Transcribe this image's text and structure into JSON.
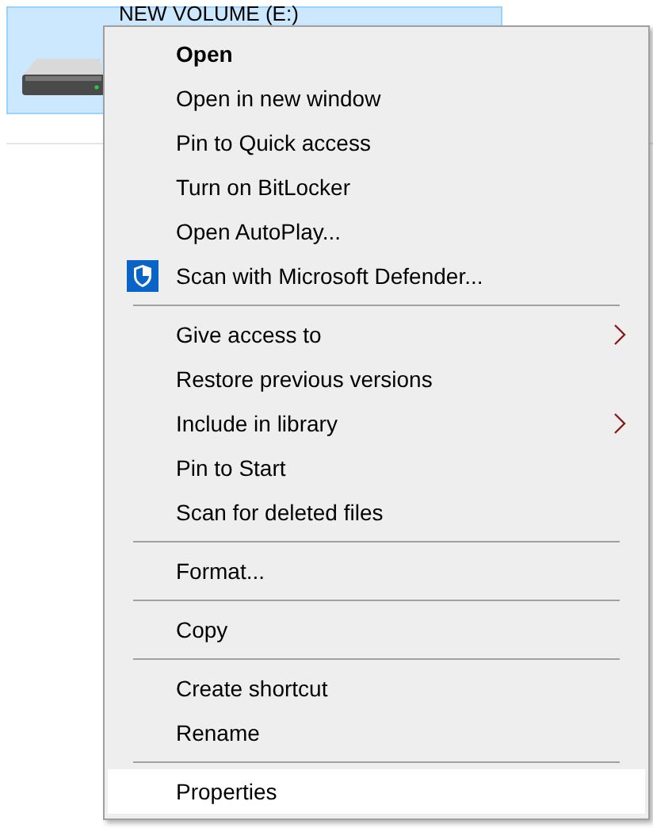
{
  "drive": {
    "label": "NEW VOLUME (E:)",
    "selected": true
  },
  "context_menu": {
    "groups": [
      {
        "items": [
          {
            "label": "Open",
            "default": true,
            "submenu": false,
            "selected": false
          },
          {
            "label": "Open in new window",
            "default": false,
            "submenu": false,
            "selected": false
          },
          {
            "label": "Pin to Quick access",
            "default": false,
            "submenu": false,
            "selected": false
          },
          {
            "label": "Turn on BitLocker",
            "default": false,
            "submenu": false,
            "selected": false
          },
          {
            "label": "Open AutoPlay...",
            "default": false,
            "submenu": false,
            "selected": false
          },
          {
            "label": "Scan with Microsoft Defender...",
            "default": false,
            "submenu": false,
            "selected": false,
            "kind": "shield"
          }
        ]
      },
      {
        "items": [
          {
            "label": "Give access to",
            "default": false,
            "submenu": true,
            "selected": false
          },
          {
            "label": "Restore previous versions",
            "default": false,
            "submenu": false,
            "selected": false
          },
          {
            "label": "Include in library",
            "default": false,
            "submenu": true,
            "selected": false
          },
          {
            "label": "Pin to Start",
            "default": false,
            "submenu": false,
            "selected": false
          },
          {
            "label": "Scan for deleted files",
            "default": false,
            "submenu": false,
            "selected": false
          }
        ]
      },
      {
        "items": [
          {
            "label": "Format...",
            "default": false,
            "submenu": false,
            "selected": false
          }
        ]
      },
      {
        "items": [
          {
            "label": "Copy",
            "default": false,
            "submenu": false,
            "selected": false
          }
        ]
      },
      {
        "items": [
          {
            "label": "Create shortcut",
            "default": false,
            "submenu": false,
            "selected": false
          },
          {
            "label": "Rename",
            "default": false,
            "submenu": false,
            "selected": false
          }
        ]
      },
      {
        "items": [
          {
            "label": "Properties",
            "default": false,
            "submenu": false,
            "selected": true
          }
        ]
      }
    ]
  }
}
